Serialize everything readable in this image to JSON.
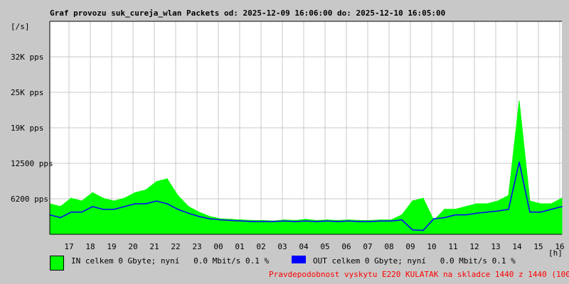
{
  "chart_data": {
    "type": "area",
    "title": "Graf provozu suk_cureja_wlan Packets od: 2025-12-09 16:06:00 do: 2025-12-10 16:05:00",
    "ylabel": "[/s]",
    "xlabel": "[h]",
    "ylim": [
      0,
      38400
    ],
    "yticks": [
      {
        "value": 6400,
        "label": "6200 pps"
      },
      {
        "value": 12800,
        "label": "12500 pps"
      },
      {
        "value": 19200,
        "label": "19K pps"
      },
      {
        "value": 25600,
        "label": "25K pps"
      },
      {
        "value": 32000,
        "label": "32K pps"
      }
    ],
    "x_start_hour_offset": 16.1,
    "xticks": [
      "17",
      "18",
      "19",
      "20",
      "21",
      "22",
      "23",
      "00",
      "01",
      "02",
      "03",
      "04",
      "05",
      "06",
      "07",
      "08",
      "09",
      "10",
      "11",
      "12",
      "13",
      "14",
      "15",
      "16"
    ],
    "x_step_hours": 0.5,
    "series": [
      {
        "name": "IN",
        "color": "#00ff00",
        "values": [
          5500,
          5000,
          6500,
          6000,
          7500,
          6500,
          6000,
          6500,
          7500,
          8000,
          9500,
          10000,
          7000,
          5000,
          4000,
          3200,
          2800,
          2700,
          2600,
          2500,
          2500,
          2400,
          2600,
          2500,
          2700,
          2500,
          2600,
          2500,
          2600,
          2500,
          2500,
          2600,
          2600,
          3500,
          6000,
          6500,
          2500,
          4500,
          4500,
          5000,
          5500,
          5500,
          6000,
          7000,
          24000,
          6000,
          5500,
          5500,
          6500
        ]
      },
      {
        "name": "OUT",
        "color": "#0000ff",
        "values": [
          3500,
          3000,
          4000,
          4000,
          5000,
          4500,
          4500,
          5000,
          5500,
          5500,
          6000,
          5500,
          4500,
          3800,
          3200,
          2800,
          2600,
          2500,
          2400,
          2300,
          2300,
          2300,
          2400,
          2300,
          2400,
          2300,
          2400,
          2300,
          2400,
          2300,
          2300,
          2400,
          2400,
          2600,
          800,
          700,
          2800,
          3000,
          3500,
          3500,
          3800,
          4000,
          4200,
          4500,
          13000,
          4000,
          4000,
          4500,
          5000
        ]
      }
    ]
  },
  "legend": {
    "in_text": "IN celkem 0 Gbyte; nyní   0.0 Mbit/s 0.1 %",
    "out_text": "OUT celkem 0 Gbyte; nyní   0.0 Mbit/s 0.1 %",
    "note": "Pravdepodobnost vyskytu E220 KULATAK na skladce 1440 z 1440 (100.0 %)",
    "note_color": "#ff0000"
  }
}
